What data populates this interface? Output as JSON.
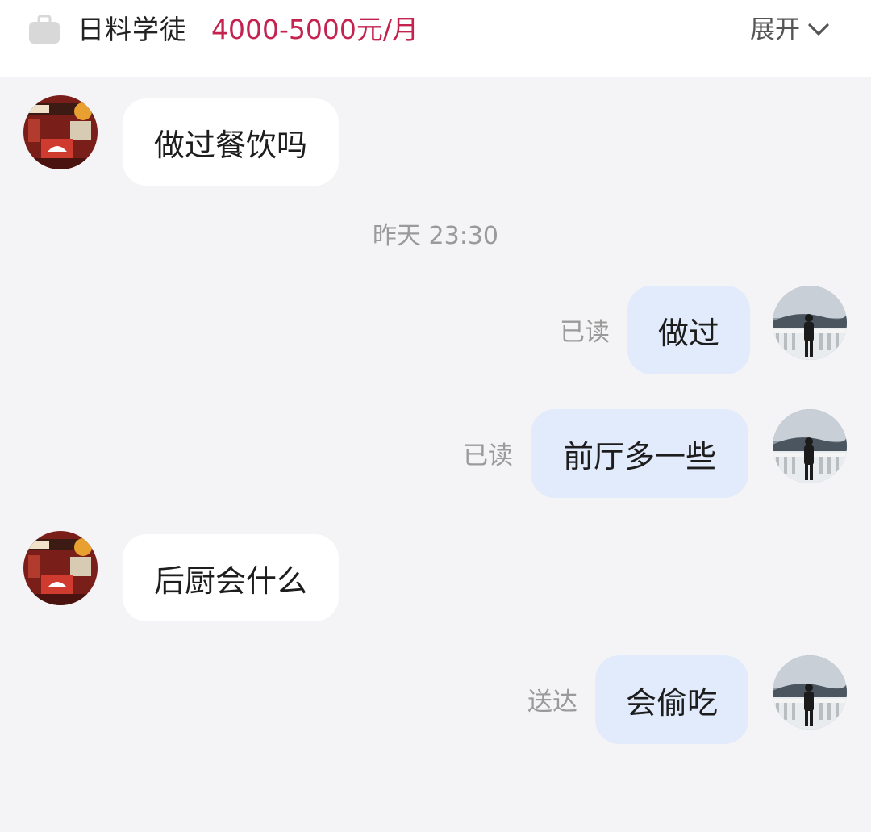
{
  "header": {
    "job_title": "日料学徒",
    "salary": "4000-5000元/月",
    "expand_label": "展开",
    "icons": {
      "job": "briefcase-icon",
      "expand": "chevron-down-icon"
    },
    "salary_color": "#c4234f"
  },
  "conversation": {
    "messages": [
      {
        "sender": "employer",
        "text": "做过餐饮吗"
      },
      {
        "timestamp": "昨天 23:30"
      },
      {
        "sender": "me",
        "text": "做过",
        "status": "已读"
      },
      {
        "sender": "me",
        "text": "前厅多一些",
        "status": "已读"
      },
      {
        "sender": "employer",
        "text": "后厨会什么"
      },
      {
        "sender": "me",
        "text": "会偷吃",
        "status": "送达"
      }
    ]
  },
  "colors": {
    "background": "#f4f4f6",
    "incoming_bubble": "#ffffff",
    "outgoing_bubble": "#e2ebfb"
  }
}
